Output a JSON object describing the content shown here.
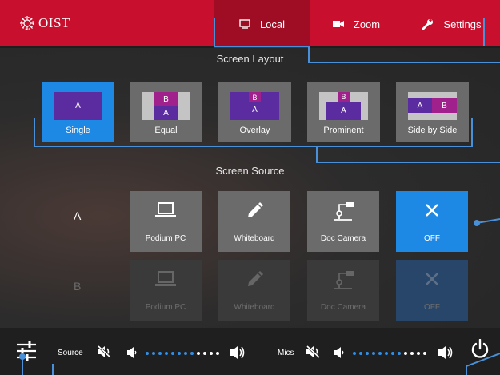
{
  "header": {
    "logo_text": "OIST",
    "tabs": [
      {
        "label": "Local",
        "icon": "display-icon",
        "active": true
      },
      {
        "label": "Zoom",
        "icon": "video-camera-icon",
        "active": false
      },
      {
        "label": "Settings",
        "icon": "wrench-icon",
        "active": false
      }
    ]
  },
  "screen_layout": {
    "title": "Screen Layout",
    "options": [
      {
        "label": "Single",
        "active": true,
        "windows": [
          "A"
        ]
      },
      {
        "label": "Equal",
        "active": false,
        "windows": [
          "B",
          "A"
        ]
      },
      {
        "label": "Overlay",
        "active": false,
        "windows": [
          "B",
          "A"
        ]
      },
      {
        "label": "Prominent",
        "active": false,
        "windows": [
          "B",
          "A"
        ]
      },
      {
        "label": "Side by Side",
        "active": false,
        "windows": [
          "A",
          "B"
        ]
      }
    ]
  },
  "screen_source": {
    "title": "Screen Source",
    "rows": [
      {
        "label": "A",
        "enabled": true,
        "sources": [
          {
            "label": "Podium PC",
            "icon": "laptop-icon",
            "active": false
          },
          {
            "label": "Whiteboard",
            "icon": "pen-icon",
            "active": false
          },
          {
            "label": "Doc Camera",
            "icon": "document-camera-icon",
            "active": false
          },
          {
            "label": "OFF",
            "icon": "close-icon",
            "active": true
          }
        ]
      },
      {
        "label": "B",
        "enabled": false,
        "sources": [
          {
            "label": "Podium PC",
            "icon": "laptop-icon",
            "active": false
          },
          {
            "label": "Whiteboard",
            "icon": "pen-icon",
            "active": false
          },
          {
            "label": "Doc Camera",
            "icon": "document-camera-icon",
            "active": false
          },
          {
            "label": "OFF",
            "icon": "close-icon",
            "active": true
          }
        ]
      }
    ]
  },
  "bottom_bar": {
    "source_label": "Source",
    "mics_label": "Mics",
    "source_volume": 0.7,
    "mics_volume": 0.7
  },
  "colors": {
    "brand_red": "#c8102e",
    "active_tab": "#9e0d24",
    "accent_blue": "#1e88e5",
    "tile_gray": "#6b6b6b",
    "annotation_line": "#4a90d9"
  }
}
